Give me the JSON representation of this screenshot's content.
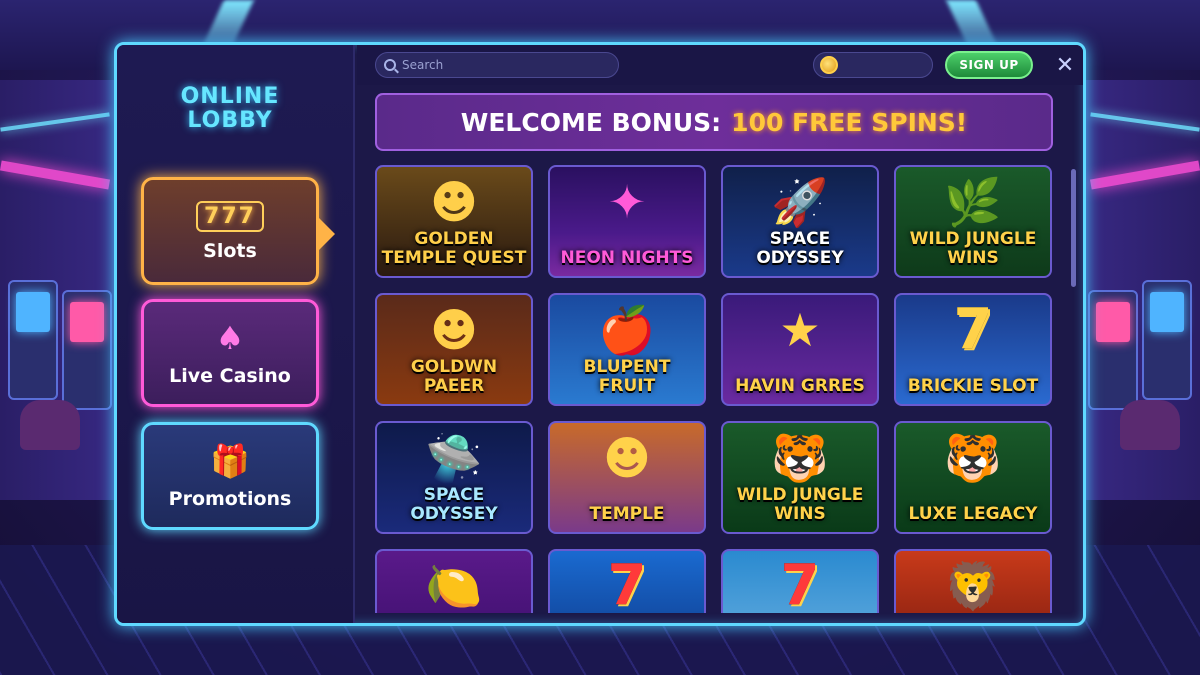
{
  "sidebar": {
    "logo_line1": "ONLINE",
    "logo_line2": "LOBBY",
    "items": [
      {
        "label": "Slots",
        "icon": "slot-machine-777-icon",
        "active": true
      },
      {
        "label": "Live Casino",
        "icon": "dealer-cards-icon",
        "active": false
      },
      {
        "label": "Promotions",
        "icon": "gift-icon",
        "active": false
      }
    ]
  },
  "topbar": {
    "search_placeholder": "Search",
    "coin_icon": "coin-icon",
    "signup_label": "SIGN UP",
    "close_icon": "close-icon"
  },
  "banner": {
    "part1": "WELCOME BONUS:",
    "part2": "100 FREE SPINS!"
  },
  "games": [
    {
      "name": "GOLDEN TEMPLE QUEST",
      "art": "pharaoh-icon"
    },
    {
      "name": "NEON NIGHTS",
      "art": "neon-text"
    },
    {
      "name": "SPACE ODYSSEY",
      "art": "rocket-icon"
    },
    {
      "name": "WILD JUNGLE WINS",
      "art": "jungle-icon"
    },
    {
      "name": "GOLDWN PAEER",
      "art": "pharaoh-mask-icon"
    },
    {
      "name": "BLUPENT FRUIT",
      "art": "fruit-icon"
    },
    {
      "name": "HAVIN GRRES",
      "art": "orange-star-icon"
    },
    {
      "name": "BRICKIE SLOT",
      "art": "seven-icon"
    },
    {
      "name": "SPACE ODYSSEY",
      "art": "ufo-icon"
    },
    {
      "name": "TEMPLE",
      "art": "pharaoh-icon"
    },
    {
      "name": "WILD JUNGLE WINS",
      "art": "tiger-icon"
    },
    {
      "name": "LUXE LEGACY",
      "art": "tiger-icon"
    },
    {
      "name": "",
      "art": "lemon-icon"
    },
    {
      "name": "",
      "art": "seven-icon"
    },
    {
      "name": "",
      "art": "seven-icon"
    },
    {
      "name": "",
      "art": "lion-icon"
    }
  ],
  "colors": {
    "accent_cyan": "#5fd9ff",
    "slots_orange": "#ffb347",
    "live_pink": "#ff5ad8",
    "bonus_gold": "#ffc83a",
    "signup_green": "#2fae4e"
  }
}
